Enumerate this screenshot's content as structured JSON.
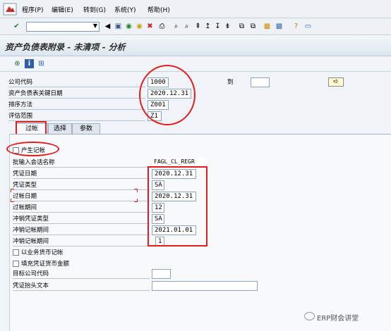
{
  "menu": {
    "items": [
      "程序(P)",
      "编辑(E)",
      "转到(G)",
      "系统(Y)",
      "帮助(H)"
    ]
  },
  "page": {
    "title": "资产负债表附录 - 未清项 - 分析"
  },
  "selection": {
    "company_code_label": "公司代码",
    "company_code_value": "1000",
    "to_label": "到",
    "key_date_label": "资产负债表关键日期",
    "key_date_value": "2020.12.31",
    "sort_method_label": "排序方法",
    "sort_method_value": "Z001",
    "valuation_area_label": "评估范围",
    "valuation_area_value": "Z1"
  },
  "tabs": [
    "过帐",
    "选择",
    "参数"
  ],
  "posting": {
    "generate_postings_label": "产生记帐",
    "batch_session_label": "批输入会话名称",
    "batch_session_value": "FAGL_CL_REGR",
    "doc_date_label": "凭证日期",
    "doc_date_value": "2020.12.31",
    "doc_type_label": "凭证类型",
    "doc_type_value": "SA",
    "posting_date_label": "过帐日期",
    "posting_date_value": "2020.12.31",
    "posting_period_label": "过帐期间",
    "posting_period_value": "12",
    "reversal_doc_type_label": "冲销凭证类型",
    "reversal_doc_type_value": "SA",
    "reversal_date_label": "冲销记帐期间",
    "reversal_date_value": "2021.01.01",
    "reversal_period_label": "冲销记帐期间",
    "reversal_period_value": "1",
    "post_in_txn_currency_label": "以业务货币记帐",
    "fill_doc_currency_label": "填充凭证货币金额",
    "target_company_label": "目标公司代码",
    "doc_header_text_label": "凭证抬头文本"
  },
  "watermark": {
    "text": "ERP财会讲堂"
  }
}
